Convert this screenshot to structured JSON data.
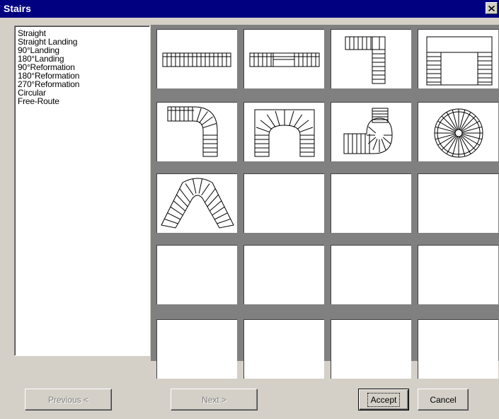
{
  "window": {
    "title": "Stairs"
  },
  "stair_types": [
    "Straight",
    "Straight Landing",
    "90°Landing",
    "180°Landing",
    "90°Reformation",
    "180°Reformation",
    "270°Reformation",
    "Circular",
    "Free-Route"
  ],
  "thumbnails": [
    {
      "icon": "straight-stair-icon"
    },
    {
      "icon": "straight-landing-stair-icon"
    },
    {
      "icon": "90-landing-stair-icon"
    },
    {
      "icon": "180-landing-stair-icon"
    },
    {
      "icon": "90-reformation-stair-icon"
    },
    {
      "icon": "180-reformation-stair-icon"
    },
    {
      "icon": "270-reformation-stair-icon"
    },
    {
      "icon": "circular-stair-icon"
    },
    {
      "icon": "free-route-stair-icon"
    }
  ],
  "buttons": {
    "previous": "Previous <",
    "next": "Next >",
    "accept": "Accept",
    "cancel": "Cancel"
  },
  "colors": {
    "titlebar": "#000080",
    "face": "#d4d0c8",
    "grid_background": "#808080"
  }
}
